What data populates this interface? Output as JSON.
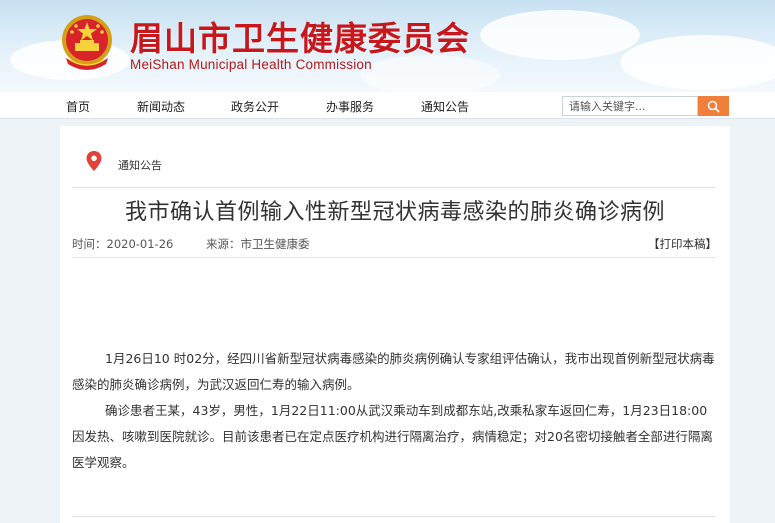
{
  "header": {
    "title": "眉山市卫生健康委员会",
    "subtitle": "MeiShan Municipal Health Commission"
  },
  "nav": {
    "items": [
      {
        "label": "首页"
      },
      {
        "label": "新闻动态"
      },
      {
        "label": "政务公开"
      },
      {
        "label": "办事服务"
      },
      {
        "label": "通知公告"
      }
    ]
  },
  "search": {
    "placeholder": "请输入关键字..."
  },
  "article": {
    "breadcrumb": "通知公告",
    "title": "我市确认首例输入性新型冠状病毒感染的肺炎确诊病例",
    "time_label": "时间：2020-01-26",
    "source_label": "来源：市卫生健康委",
    "print_label": "【打印本稿】",
    "paragraphs": [
      "1月26日10 时02分，经四川省新型冠状病毒感染的肺炎病例确认专家组评估确认，我市出现首例新型冠状病毒感染的肺炎确诊病例，为武汉返回仁寿的输入病例。",
      "确诊患者王某，43岁，男性，1月22日11:00从武汉乘动车到成都东站,改乘私家车返回仁寿，1月23日18:00因发热、咳嗽到医院就诊。目前该患者已在定点医疗机构进行隔离治疗，病情稳定；对20名密切接触者全部进行隔离医学观察。"
    ]
  },
  "colors": {
    "brand_red": "#c8161d",
    "search_button": "#ef7f3a",
    "pin": "#e0423a"
  },
  "icons": {
    "emblem": "national-emblem-icon",
    "search": "search-icon",
    "location": "location-pin-icon"
  }
}
